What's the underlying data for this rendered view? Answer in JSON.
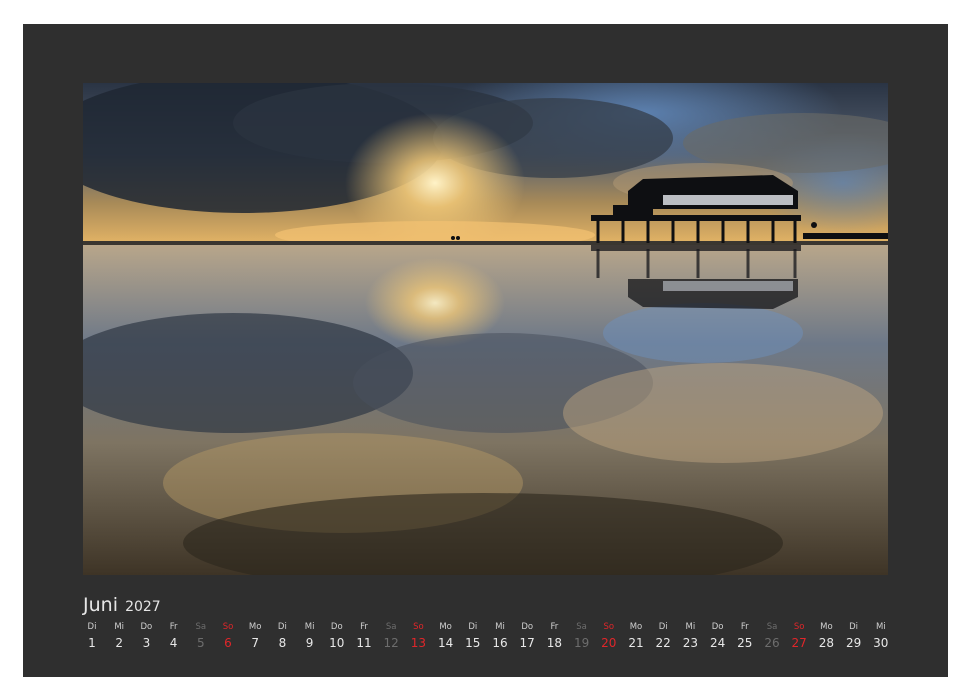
{
  "calendar": {
    "month": "Juni",
    "year": "2027",
    "days": [
      {
        "wd": "Di",
        "d": "1",
        "k": ""
      },
      {
        "wd": "Mi",
        "d": "2",
        "k": ""
      },
      {
        "wd": "Do",
        "d": "3",
        "k": ""
      },
      {
        "wd": "Fr",
        "d": "4",
        "k": ""
      },
      {
        "wd": "Sa",
        "d": "5",
        "k": "sat"
      },
      {
        "wd": "So",
        "d": "6",
        "k": "sun"
      },
      {
        "wd": "Mo",
        "d": "7",
        "k": ""
      },
      {
        "wd": "Di",
        "d": "8",
        "k": ""
      },
      {
        "wd": "Mi",
        "d": "9",
        "k": ""
      },
      {
        "wd": "Do",
        "d": "10",
        "k": ""
      },
      {
        "wd": "Fr",
        "d": "11",
        "k": ""
      },
      {
        "wd": "Sa",
        "d": "12",
        "k": "sat"
      },
      {
        "wd": "So",
        "d": "13",
        "k": "sun"
      },
      {
        "wd": "Mo",
        "d": "14",
        "k": ""
      },
      {
        "wd": "Di",
        "d": "15",
        "k": ""
      },
      {
        "wd": "Mi",
        "d": "16",
        "k": ""
      },
      {
        "wd": "Do",
        "d": "17",
        "k": ""
      },
      {
        "wd": "Fr",
        "d": "18",
        "k": ""
      },
      {
        "wd": "Sa",
        "d": "19",
        "k": "sat"
      },
      {
        "wd": "So",
        "d": "20",
        "k": "sun"
      },
      {
        "wd": "Mo",
        "d": "21",
        "k": ""
      },
      {
        "wd": "Di",
        "d": "22",
        "k": ""
      },
      {
        "wd": "Mi",
        "d": "23",
        "k": ""
      },
      {
        "wd": "Do",
        "d": "24",
        "k": ""
      },
      {
        "wd": "Fr",
        "d": "25",
        "k": ""
      },
      {
        "wd": "Sa",
        "d": "26",
        "k": "sat"
      },
      {
        "wd": "So",
        "d": "27",
        "k": "sun"
      },
      {
        "wd": "Mo",
        "d": "28",
        "k": ""
      },
      {
        "wd": "Di",
        "d": "29",
        "k": ""
      },
      {
        "wd": "Mi",
        "d": "30",
        "k": ""
      }
    ]
  },
  "photo": {
    "subject": "stilt-house-sunset-reflection"
  },
  "colors": {
    "page_background": "#2f2f2f",
    "sunday": "#e0262a",
    "saturday": "#6d6d6d",
    "text": "#e8e8e8"
  }
}
